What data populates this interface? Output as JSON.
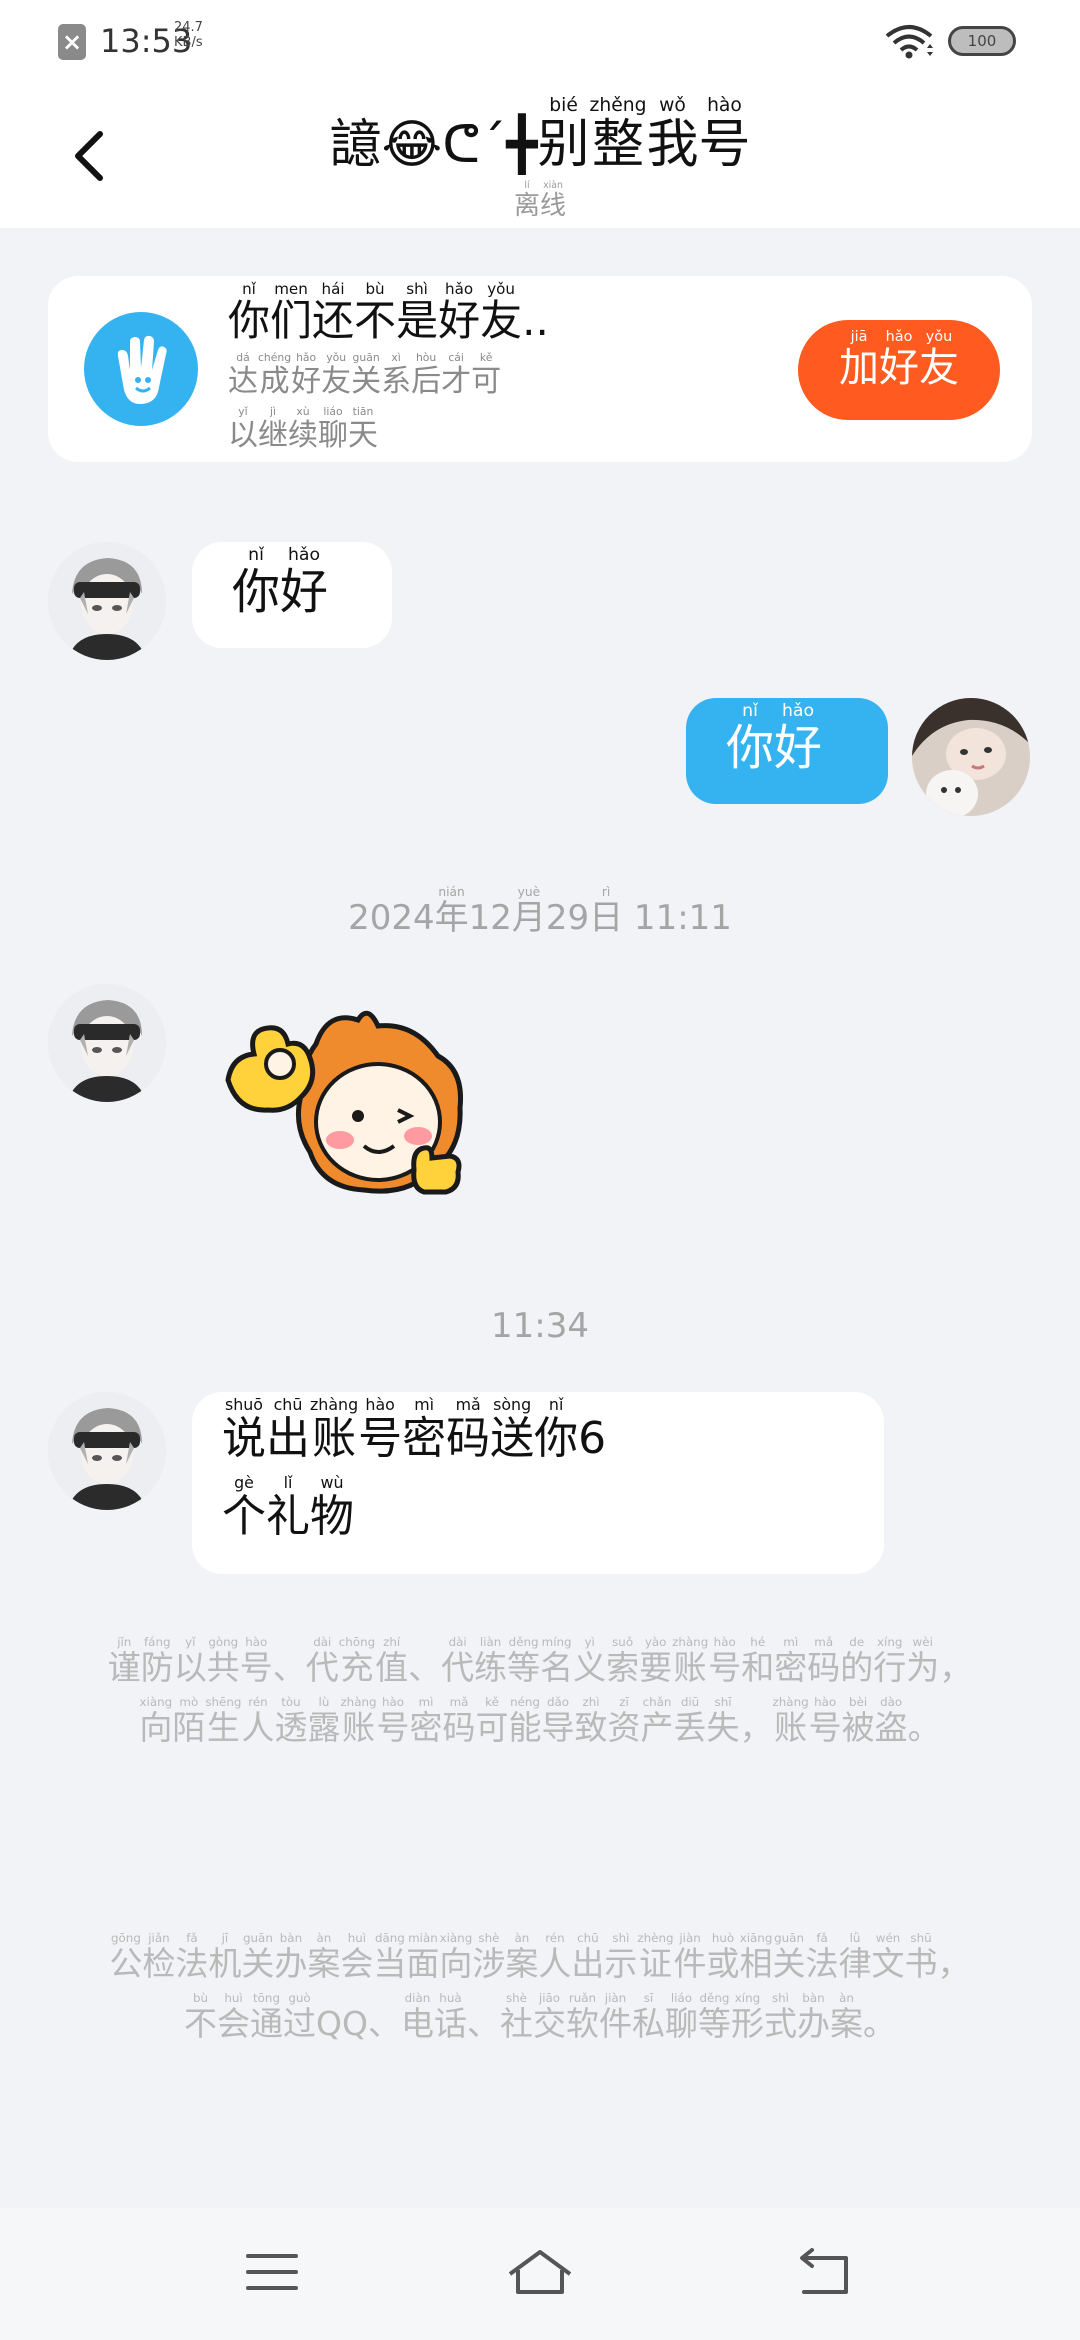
{
  "status_bar": {
    "time": "13:53",
    "net_speed_value": "24.7",
    "net_speed_unit": "KB/s",
    "battery": "100"
  },
  "header": {
    "title_left": "譩😂ᕦ´╋",
    "title_ruby": [
      {
        "ch": "别",
        "py": "bié"
      },
      {
        "ch": "整",
        "py": "zhěng"
      },
      {
        "ch": "我",
        "py": "wǒ"
      },
      {
        "ch": "号",
        "py": "hào"
      }
    ],
    "subtitle_ruby": [
      {
        "ch": "离",
        "py": "lí"
      },
      {
        "ch": "线",
        "py": "xiàn"
      }
    ]
  },
  "friend_banner": {
    "title_ruby": [
      {
        "ch": "你",
        "py": "nǐ"
      },
      {
        "ch": "们",
        "py": "men"
      },
      {
        "ch": "还",
        "py": "hái"
      },
      {
        "ch": "不",
        "py": "bù"
      },
      {
        "ch": "是",
        "py": "shì"
      },
      {
        "ch": "好",
        "py": "hǎo"
      },
      {
        "ch": "友",
        "py": "yǒu"
      },
      {
        "ch": "..",
        "py": ""
      }
    ],
    "desc_line1": [
      {
        "ch": "达",
        "py": "dá"
      },
      {
        "ch": "成",
        "py": "chéng"
      },
      {
        "ch": "好",
        "py": "hǎo"
      },
      {
        "ch": "友",
        "py": "yǒu"
      },
      {
        "ch": "关",
        "py": "guān"
      },
      {
        "ch": "系",
        "py": "xì"
      },
      {
        "ch": "后",
        "py": "hòu"
      },
      {
        "ch": "才",
        "py": "cái"
      },
      {
        "ch": "可",
        "py": "kě"
      }
    ],
    "desc_line2": [
      {
        "ch": "以",
        "py": "yǐ"
      },
      {
        "ch": "继",
        "py": "jì"
      },
      {
        "ch": "续",
        "py": "xù"
      },
      {
        "ch": "聊",
        "py": "liáo"
      },
      {
        "ch": "天",
        "py": "tiān"
      }
    ],
    "button_ruby": [
      {
        "ch": "加",
        "py": "jiā"
      },
      {
        "ch": "好",
        "py": "hǎo"
      },
      {
        "ch": "友",
        "py": "yǒu"
      }
    ]
  },
  "messages": {
    "m1": [
      {
        "ch": "你",
        "py": "nǐ"
      },
      {
        "ch": "好",
        "py": "hǎo"
      }
    ],
    "m2": [
      {
        "ch": "你",
        "py": "nǐ"
      },
      {
        "ch": "好",
        "py": "hǎo"
      }
    ],
    "separator1": [
      {
        "ch": "2024",
        "py": ""
      },
      {
        "ch": "年",
        "py": "nián"
      },
      {
        "ch": "12",
        "py": ""
      },
      {
        "ch": "月",
        "py": "yuè"
      },
      {
        "ch": "29",
        "py": ""
      },
      {
        "ch": "日",
        "py": "rì"
      },
      {
        "ch": "  11:11",
        "py": ""
      }
    ],
    "separator2": "11:34",
    "m4_line1": [
      {
        "ch": "说",
        "py": "shuō"
      },
      {
        "ch": "出",
        "py": "chū"
      },
      {
        "ch": "账",
        "py": "zhàng"
      },
      {
        "ch": "号",
        "py": "hào"
      },
      {
        "ch": "密",
        "py": "mì"
      },
      {
        "ch": "码",
        "py": "mǎ"
      },
      {
        "ch": "送",
        "py": "sòng"
      },
      {
        "ch": "你",
        "py": "nǐ"
      },
      {
        "ch": "6",
        "py": ""
      }
    ],
    "m4_line2": [
      {
        "ch": "个",
        "py": "gè"
      },
      {
        "ch": "礼",
        "py": "lǐ"
      },
      {
        "ch": "物",
        "py": "wù"
      }
    ]
  },
  "notices": {
    "n1": [
      {
        "ch": "谨",
        "py": "jǐn"
      },
      {
        "ch": "防",
        "py": "fáng"
      },
      {
        "ch": "以",
        "py": "yǐ"
      },
      {
        "ch": "共",
        "py": "gòng"
      },
      {
        "ch": "号",
        "py": "hào"
      },
      {
        "ch": "、",
        "py": ""
      },
      {
        "ch": "代",
        "py": "dài"
      },
      {
        "ch": "充",
        "py": "chōng"
      },
      {
        "ch": "值",
        "py": "zhí"
      },
      {
        "ch": "、",
        "py": ""
      },
      {
        "ch": "代",
        "py": "dài"
      },
      {
        "ch": "练",
        "py": "liàn"
      },
      {
        "ch": "等",
        "py": "děng"
      },
      {
        "ch": "名",
        "py": "míng"
      },
      {
        "ch": "义",
        "py": "yì"
      },
      {
        "ch": "索",
        "py": "suǒ"
      },
      {
        "ch": "要",
        "py": "yào"
      },
      {
        "ch": "账",
        "py": "zhàng"
      },
      {
        "ch": "号",
        "py": "hào"
      },
      {
        "ch": "和",
        "py": "hé"
      },
      {
        "ch": "密",
        "py": "mì"
      },
      {
        "ch": "码",
        "py": "mǎ"
      },
      {
        "ch": "的",
        "py": "de"
      },
      {
        "ch": "行",
        "py": "xíng"
      },
      {
        "ch": "为",
        "py": "wèi"
      },
      {
        "ch": "，",
        "py": ""
      },
      {
        "ch": "向",
        "py": "xiàng"
      },
      {
        "ch": "陌",
        "py": "mò"
      },
      {
        "ch": "生",
        "py": "shēng"
      },
      {
        "ch": "人",
        "py": "rén"
      },
      {
        "ch": "透",
        "py": "tòu"
      },
      {
        "ch": "露",
        "py": "lù"
      },
      {
        "ch": "账",
        "py": "zhàng"
      },
      {
        "ch": "号",
        "py": "hào"
      },
      {
        "ch": "密",
        "py": "mì"
      },
      {
        "ch": "码",
        "py": "mǎ"
      },
      {
        "ch": "可",
        "py": "kě"
      },
      {
        "ch": "能",
        "py": "néng"
      },
      {
        "ch": "导",
        "py": "dǎo"
      },
      {
        "ch": "致",
        "py": "zhì"
      },
      {
        "ch": "资",
        "py": "zī"
      },
      {
        "ch": "产",
        "py": "chǎn"
      },
      {
        "ch": "丢",
        "py": "diū"
      },
      {
        "ch": "失",
        "py": "shī"
      },
      {
        "ch": "，",
        "py": ""
      },
      {
        "ch": "账",
        "py": "zhàng"
      },
      {
        "ch": "号",
        "py": "hào"
      },
      {
        "ch": "被",
        "py": "bèi"
      },
      {
        "ch": "盗",
        "py": "dào"
      },
      {
        "ch": "。",
        "py": ""
      }
    ],
    "n2": [
      {
        "ch": "公",
        "py": "gōng"
      },
      {
        "ch": "检",
        "py": "jiǎn"
      },
      {
        "ch": "法",
        "py": "fǎ"
      },
      {
        "ch": "机",
        "py": "jī"
      },
      {
        "ch": "关",
        "py": "guān"
      },
      {
        "ch": "办",
        "py": "bàn"
      },
      {
        "ch": "案",
        "py": "àn"
      },
      {
        "ch": "会",
        "py": "huì"
      },
      {
        "ch": "当",
        "py": "dāng"
      },
      {
        "ch": "面",
        "py": "miàn"
      },
      {
        "ch": "向",
        "py": "xiàng"
      },
      {
        "ch": "涉",
        "py": "shè"
      },
      {
        "ch": "案",
        "py": "àn"
      },
      {
        "ch": "人",
        "py": "rén"
      },
      {
        "ch": "出",
        "py": "chū"
      },
      {
        "ch": "示",
        "py": "shì"
      },
      {
        "ch": "证",
        "py": "zhèng"
      },
      {
        "ch": "件",
        "py": "jiàn"
      },
      {
        "ch": "或",
        "py": "huò"
      },
      {
        "ch": "相",
        "py": "xiāng"
      },
      {
        "ch": "关",
        "py": "guān"
      },
      {
        "ch": "法",
        "py": "fǎ"
      },
      {
        "ch": "律",
        "py": "lǜ"
      },
      {
        "ch": "文",
        "py": "wén"
      },
      {
        "ch": "书",
        "py": "shū"
      },
      {
        "ch": "，",
        "py": ""
      },
      {
        "ch": "不",
        "py": "bù"
      },
      {
        "ch": "会",
        "py": "huì"
      },
      {
        "ch": "通",
        "py": "tōng"
      },
      {
        "ch": "过",
        "py": "guò"
      },
      {
        "ch": "QQ、",
        "py": ""
      },
      {
        "ch": "电",
        "py": "diàn"
      },
      {
        "ch": "话",
        "py": "huà"
      },
      {
        "ch": "、",
        "py": ""
      },
      {
        "ch": "社",
        "py": "shè"
      },
      {
        "ch": "交",
        "py": "jiāo"
      },
      {
        "ch": "软",
        "py": "ruǎn"
      },
      {
        "ch": "件",
        "py": "jiàn"
      },
      {
        "ch": "私",
        "py": "sī"
      },
      {
        "ch": "聊",
        "py": "liáo"
      },
      {
        "ch": "等",
        "py": "děng"
      },
      {
        "ch": "形",
        "py": "xíng"
      },
      {
        "ch": "式",
        "py": "shì"
      },
      {
        "ch": "办",
        "py": "bàn"
      },
      {
        "ch": "案",
        "py": "àn"
      },
      {
        "ch": "。",
        "py": ""
      }
    ]
  },
  "colors": {
    "accent_blue": "#35b3f0",
    "add_friend_orange": "#ff5a1f",
    "background": "#f1f3f6"
  },
  "icons": {
    "status_notification": "close-notification-icon",
    "wifi": "wifi-icon",
    "back": "chevron-left-icon",
    "banner": "hand-wave-icon",
    "nav_menu": "menu-icon",
    "nav_home": "home-icon",
    "nav_back": "return-icon"
  }
}
